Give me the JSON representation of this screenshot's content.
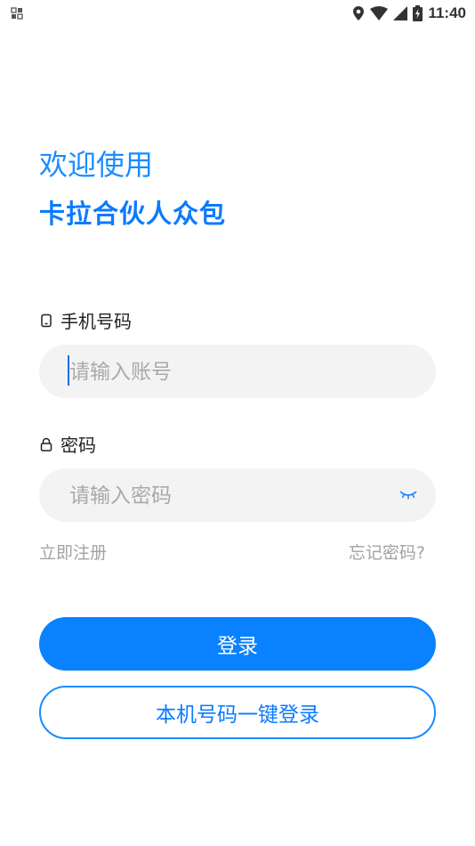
{
  "status_bar": {
    "time": "11:40",
    "icons": [
      "app-grid-icon",
      "location-icon",
      "wifi-icon",
      "cell-signal-icon",
      "battery-icon"
    ]
  },
  "header": {
    "welcome": "欢迎使用",
    "brand": "卡拉合伙人众包"
  },
  "phone_field": {
    "label": "手机号码",
    "icon": "phone-icon",
    "value": "",
    "placeholder": "请输入账号"
  },
  "password_field": {
    "label": "密码",
    "icon": "lock-icon",
    "value": "",
    "placeholder": "请输入密码",
    "toggle_icon": "eye-closed-icon"
  },
  "links": {
    "register": "立即注册",
    "forgot": "忘记密码?"
  },
  "buttons": {
    "login": "登录",
    "one_click_login": "本机号码一键登录"
  },
  "colors": {
    "accent": "#0a82ff",
    "input_bg": "#f3f3f3",
    "link": "#a3a3a3"
  }
}
